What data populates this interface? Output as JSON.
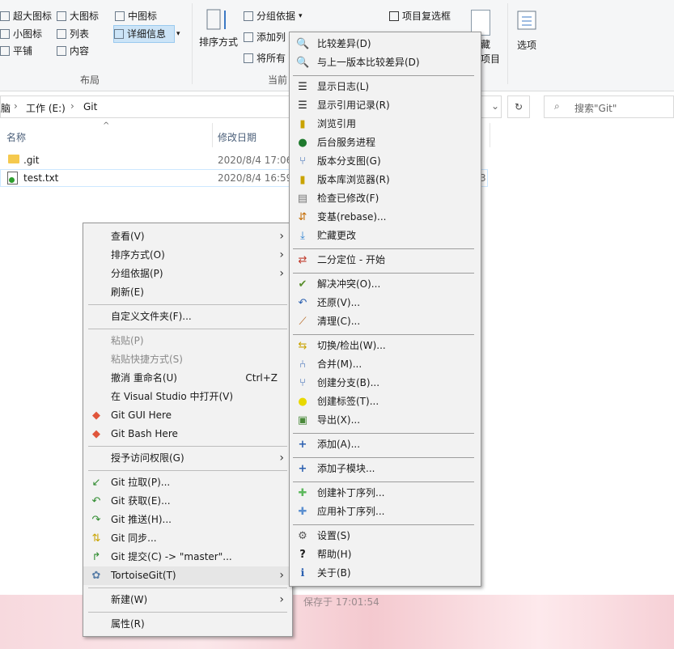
{
  "ribbon": {
    "layout": {
      "extra_large_icons": "超大图标",
      "large_icons": "大图标",
      "medium_icons": "中图标",
      "small_icons": "小图标",
      "list": "列表",
      "details": "详细信息",
      "tiles": "平铺",
      "content": "内容",
      "group_label": "布局"
    },
    "current_view": {
      "sort_by": "排序方式",
      "group_by": "分组依据",
      "add_columns": "添加列",
      "fit_columns": "将所有",
      "group_label": "当前"
    },
    "show_hide": {
      "item_checkboxes": "项目复选框",
      "hide_selected_1": "藏",
      "hide_selected_2": "项目"
    },
    "options": "选项"
  },
  "address": {
    "breadcrumb_prefix": "脑",
    "drive": "工作 (E:)",
    "folder": "Git",
    "search_placeholder": "搜索\"Git\""
  },
  "columns": {
    "name": "名称",
    "modified": "修改日期"
  },
  "files": [
    {
      "name": ".git",
      "modified": "2020/8/4 17:06"
    },
    {
      "name": "test.txt",
      "modified": "2020/8/4 16:59",
      "size_fragment": "3"
    }
  ],
  "status_text": "保存于 17:01:54",
  "context_menu": {
    "items": [
      "查看(V)",
      "排序方式(O)",
      "分组依据(P)",
      "刷新(E)",
      "自定义文件夹(F)...",
      "粘贴(P)",
      "粘贴快捷方式(S)",
      "撤消 重命名(U)",
      "在 Visual Studio 中打开(V)",
      "Git GUI Here",
      "Git Bash Here",
      "授予访问权限(G)",
      "Git 拉取(P)...",
      "Git 获取(E)...",
      "Git 推送(H)...",
      "Git 同步...",
      "Git 提交(C) -> \"master\"...",
      "TortoiseGit(T)",
      "新建(W)",
      "属性(R)"
    ],
    "undo_shortcut": "Ctrl+Z"
  },
  "tortoise_menu": {
    "items": [
      "比较差异(D)",
      "与上一版本比较差异(D)",
      "显示日志(L)",
      "显示引用记录(R)",
      "浏览引用",
      "后台服务进程",
      "版本分支图(G)",
      "版本库浏览器(R)",
      "检查已修改(F)",
      "变基(rebase)...",
      "贮藏更改",
      "二分定位 - 开始",
      "解决冲突(O)...",
      "还原(V)...",
      "清理(C)...",
      "切换/检出(W)...",
      "合并(M)...",
      "创建分支(B)...",
      "创建标签(T)...",
      "导出(X)...",
      "添加(A)...",
      "添加子模块...",
      "创建补丁序列...",
      "应用补丁序列...",
      "设置(S)",
      "帮助(H)",
      "关于(B)"
    ]
  },
  "colors": {
    "selection": "#cce4f7",
    "menu_bg": "#f2f2f2",
    "accent": "#0078d7"
  }
}
